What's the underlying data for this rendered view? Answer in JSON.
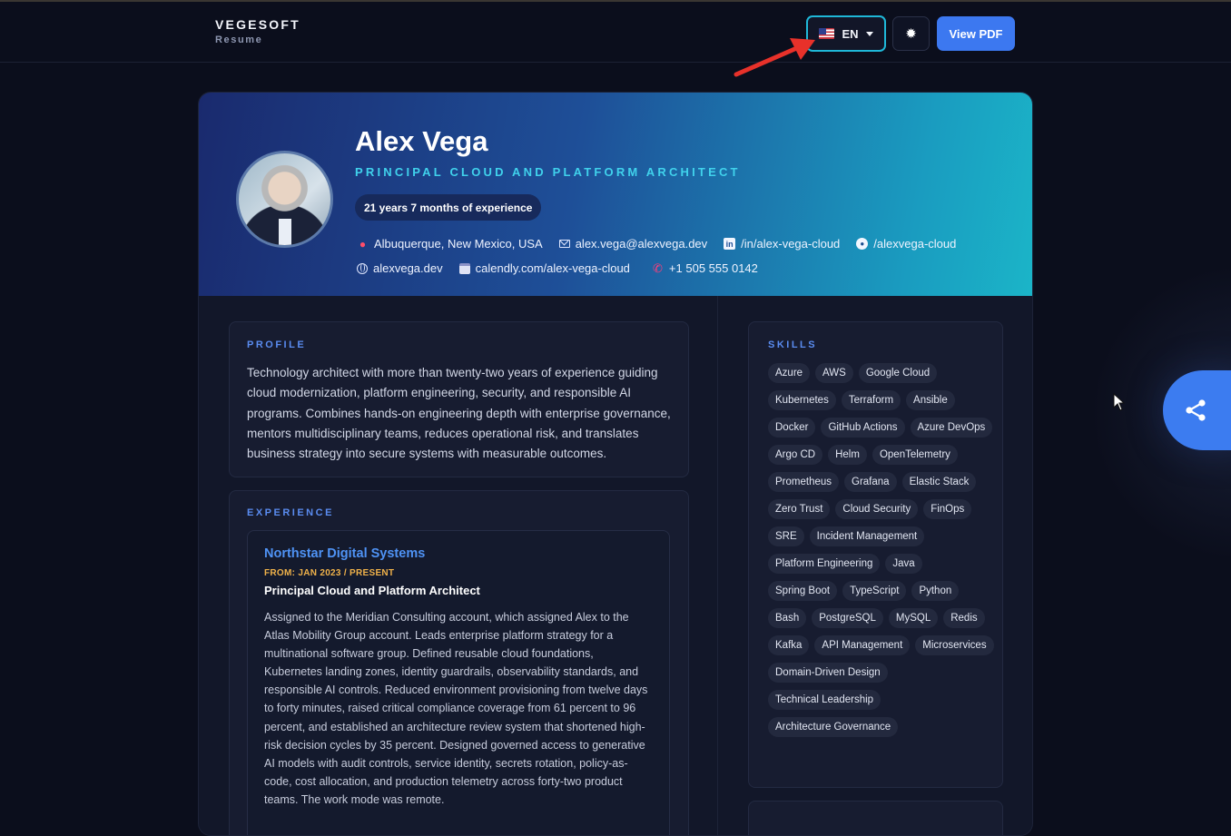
{
  "navbar": {
    "brand_name": "VEGESOFT",
    "brand_sub": "Resume",
    "language": {
      "code": "EN",
      "flag": "us-flag-icon"
    },
    "theme_icon": "✹",
    "pdf_label": "View PDF"
  },
  "hero": {
    "name": "Alex Vega",
    "title": "PRINCIPAL CLOUD AND PLATFORM ARCHITECT",
    "experience": "21 years 7 months of experience",
    "contacts_row1": [
      {
        "icon": "location-pin-icon",
        "glyph": "📍",
        "text": "Albuquerque, New Mexico, USA"
      },
      {
        "icon": "mail-icon",
        "glyph": "",
        "text": "alex.vega@alexvega.dev"
      },
      {
        "icon": "linkedin-icon",
        "glyph": "in",
        "text": "/in/alex-vega-cloud"
      },
      {
        "icon": "github-icon",
        "glyph": "gh",
        "text": "/alexvega-cloud"
      }
    ],
    "contacts_row2": [
      {
        "icon": "globe-icon",
        "glyph": "",
        "text": "alexvega.dev"
      },
      {
        "icon": "calendar-icon",
        "glyph": "",
        "text": "calendly.com/alex-vega-cloud"
      },
      {
        "icon": "phone-icon",
        "glyph": "📞",
        "text": "+1 505 555 0142"
      }
    ]
  },
  "profile": {
    "label": "PROFILE",
    "text": "Technology architect with more than twenty-two years of experience guiding cloud modernization, platform engineering, security, and responsible AI programs. Combines hands-on engineering depth with enterprise governance, mentors multidisciplinary teams, reduces operational risk, and translates business strategy into secure systems with measurable outcomes."
  },
  "experience": {
    "label": "EXPERIENCE",
    "jobs": [
      {
        "company": "Northstar Digital Systems",
        "dates": "FROM: JAN 2023 / PRESENT",
        "role": "Principal Cloud and Platform Architect",
        "description": "Assigned to the Meridian Consulting account, which assigned Alex to the Atlas Mobility Group account. Leads enterprise platform strategy for a multinational software group. Defined reusable cloud foundations, Kubernetes landing zones, identity guardrails, observability standards, and responsible AI controls. Reduced environment provisioning from twelve days to forty minutes, raised critical compliance coverage from 61 percent to 96 percent, and established an architecture review system that shortened high-risk decision cycles by 35 percent. Designed governed access to generative AI models with audit controls, service identity, secrets rotation, policy-as-code, cost allocation, and production telemetry across forty-two product teams. The work mode was remote."
      }
    ]
  },
  "skills": {
    "label": "SKILLS",
    "items": [
      "Azure",
      "AWS",
      "Google Cloud",
      "Kubernetes",
      "Terraform",
      "Ansible",
      "Docker",
      "GitHub Actions",
      "Azure DevOps",
      "Argo CD",
      "Helm",
      "OpenTelemetry",
      "Prometheus",
      "Grafana",
      "Elastic Stack",
      "Zero Trust",
      "Cloud Security",
      "FinOps",
      "SRE",
      "Incident Management",
      "Platform Engineering",
      "Java",
      "Spring Boot",
      "TypeScript",
      "Python",
      "Bash",
      "PostgreSQL",
      "MySQL",
      "Redis",
      "Kafka",
      "API Management",
      "Microservices",
      "Domain-Driven Design",
      "Technical Leadership",
      "Architecture Governance"
    ]
  },
  "share": {
    "icon": "share-icon"
  },
  "colors": {
    "accent": "#3c7cf0",
    "title_cyan": "#40d2ec",
    "date_orange": "#f0b24a",
    "annotation_arrow": "#e8312a"
  }
}
